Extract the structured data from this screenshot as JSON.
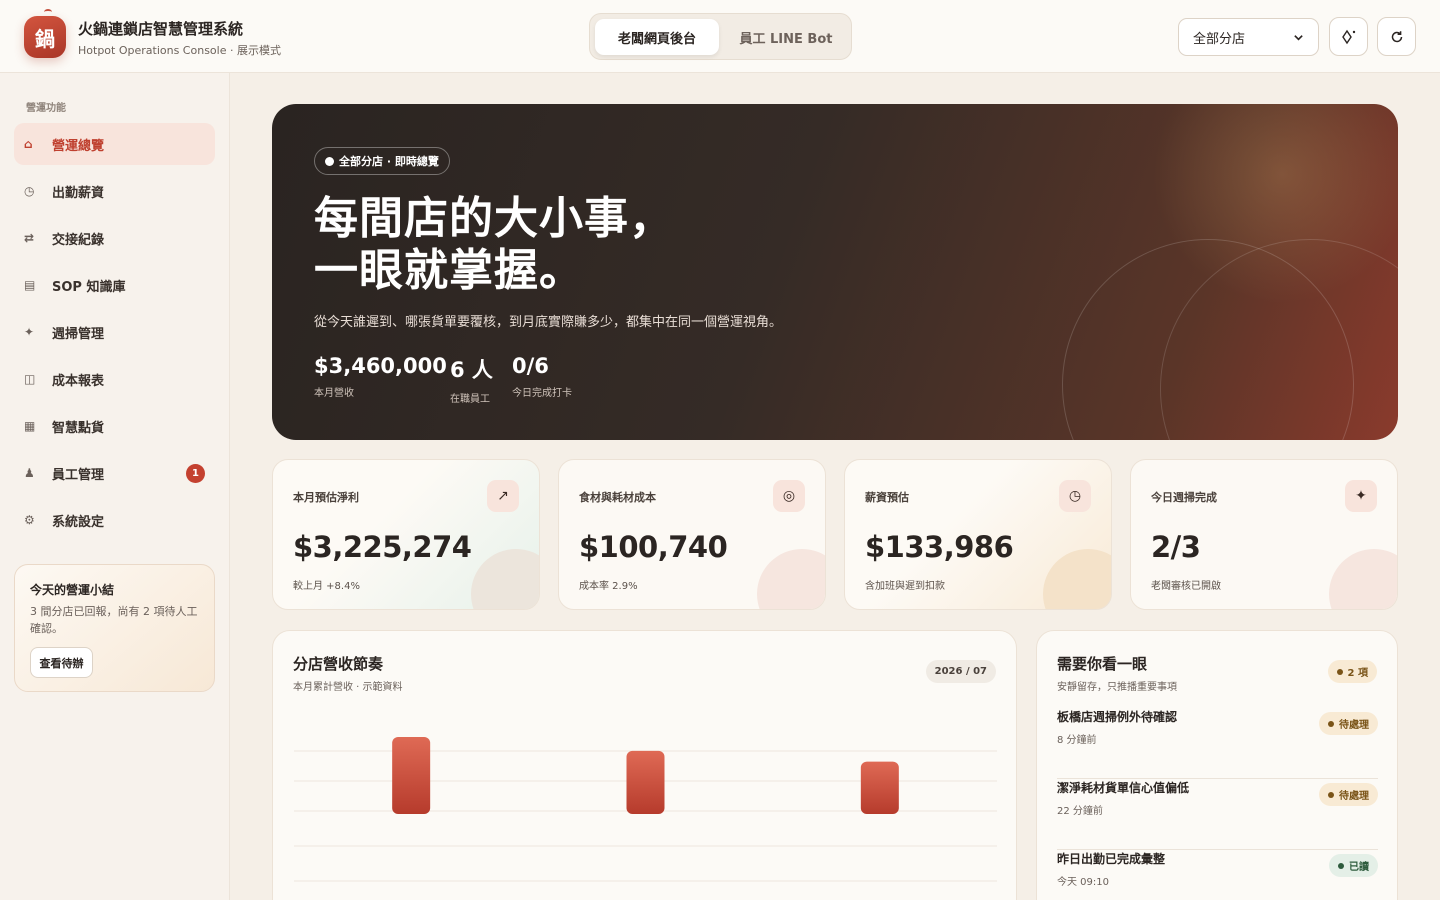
{
  "app": {
    "logo_char": "鍋",
    "title": "火鍋連鎖店智慧管理系統",
    "subtitle": "Hotpot Operations Console · 展示模式"
  },
  "mode_tabs": [
    {
      "label": "老闆網頁後台",
      "active": true
    },
    {
      "label": "員工 LINE Bot",
      "active": false
    }
  ],
  "branch_select": {
    "value": "全部分店"
  },
  "icons": {
    "theme": "sparkle-diamond-icon",
    "refresh": "refresh-icon"
  },
  "sidebar": {
    "section_label": "營運功能",
    "items": [
      {
        "icon": "⌂",
        "label": "營運總覽",
        "active": true
      },
      {
        "icon": "◷",
        "label": "出勤薪資"
      },
      {
        "icon": "⇄",
        "label": "交接紀錄"
      },
      {
        "icon": "▤",
        "label": "SOP 知識庫"
      },
      {
        "icon": "✦",
        "label": "週掃管理"
      },
      {
        "icon": "◫",
        "label": "成本報表"
      },
      {
        "icon": "▦",
        "label": "智慧點貨"
      },
      {
        "icon": "♟",
        "label": "員工管理",
        "badge": "1"
      },
      {
        "icon": "⚙",
        "label": "系統設定"
      }
    ],
    "summary": {
      "title": "今天的營運小結",
      "body": "3 間分店已回報，尚有 2 項待人工確認。",
      "button": "查看待辦"
    }
  },
  "hero": {
    "pill": "全部分店 · 即時總覽",
    "headline_1": "每間店的大小事，",
    "headline_2": "一眼就掌握。",
    "desc": "從今天誰遲到、哪張貨單要覆核，到月底實際賺多少，都集中在同一個營運視角。",
    "stats": [
      {
        "value": "$3,460,000",
        "label": "本月營收"
      },
      {
        "value": "6 人",
        "label": "在職員工"
      },
      {
        "value": "0/6",
        "label": "今日完成打卡"
      }
    ]
  },
  "cards": [
    {
      "title": "本月預估淨利",
      "icon": "↗",
      "value": "$3,225,274",
      "sub": "較上月 +8.4%"
    },
    {
      "title": "食材與耗材成本",
      "icon": "◎",
      "value": "$100,740",
      "sub": "成本率 2.9%"
    },
    {
      "title": "薪資預估",
      "icon": "◷",
      "value": "$133,986",
      "sub": "含加班與遲到扣款"
    },
    {
      "title": "今日週掃完成",
      "icon": "✦",
      "value": "2/3",
      "sub": "老闆審核已開啟"
    }
  ],
  "revenue_panel": {
    "title": "分店營收節奏",
    "subtitle": "本月累計營收 · 示範資料",
    "tag": "2026 / 07"
  },
  "chart_data": {
    "type": "bar",
    "categories": [
      "",
      "",
      ""
    ],
    "values": [
      1.0,
      0.82,
      0.68
    ],
    "colors": {
      "bar_top": "#df6a55",
      "bar_bottom": "#b63b2c"
    },
    "grid": true
  },
  "alerts_panel": {
    "title": "需要你看一眼",
    "subtitle": "安靜留存，只推播重要事項",
    "count": "2 項",
    "items": [
      {
        "title": "板橋店週掃例外待確認",
        "meta": "8 分鐘前",
        "status": "待處理",
        "kind": "pend"
      },
      {
        "title": "潔淨耗材貨單信心值偏低",
        "meta": "22 分鐘前",
        "status": "待處理",
        "kind": "pend"
      },
      {
        "title": "昨日出勤已完成彙整",
        "meta": "今天 09:10",
        "status": "已讀",
        "kind": "done"
      }
    ]
  }
}
